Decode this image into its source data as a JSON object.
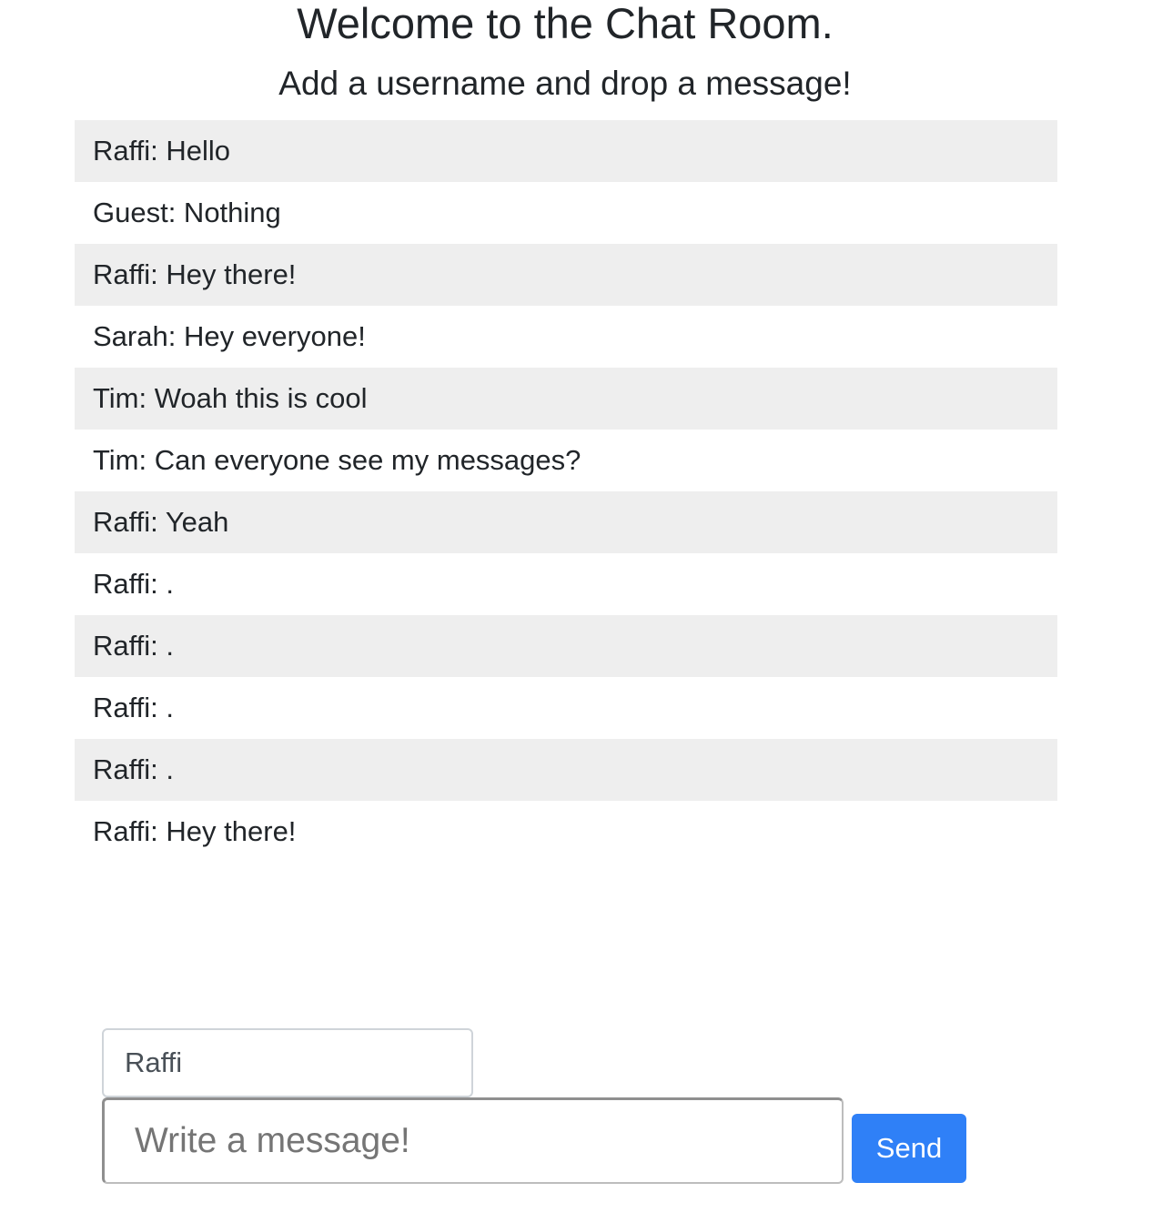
{
  "header": {
    "title": "Welcome to the Chat Room.",
    "subtitle": "Add a username and drop a message!"
  },
  "messages": [
    "Raffi: Hello",
    "Guest: Nothing",
    "Raffi: Hey there!",
    "Sarah: Hey everyone!",
    "Tim: Woah this is cool",
    "Tim: Can everyone see my messages?",
    "Raffi: Yeah",
    "Raffi: .",
    "Raffi: .",
    "Raffi: .",
    "Raffi: .",
    "Raffi: Hey there!"
  ],
  "form": {
    "username_value": "Raffi",
    "message_value": "",
    "message_placeholder": "Write a message!",
    "send_label": "Send"
  },
  "colors": {
    "send_button": "#2f80f7",
    "row_alt": "#eeeeee"
  }
}
